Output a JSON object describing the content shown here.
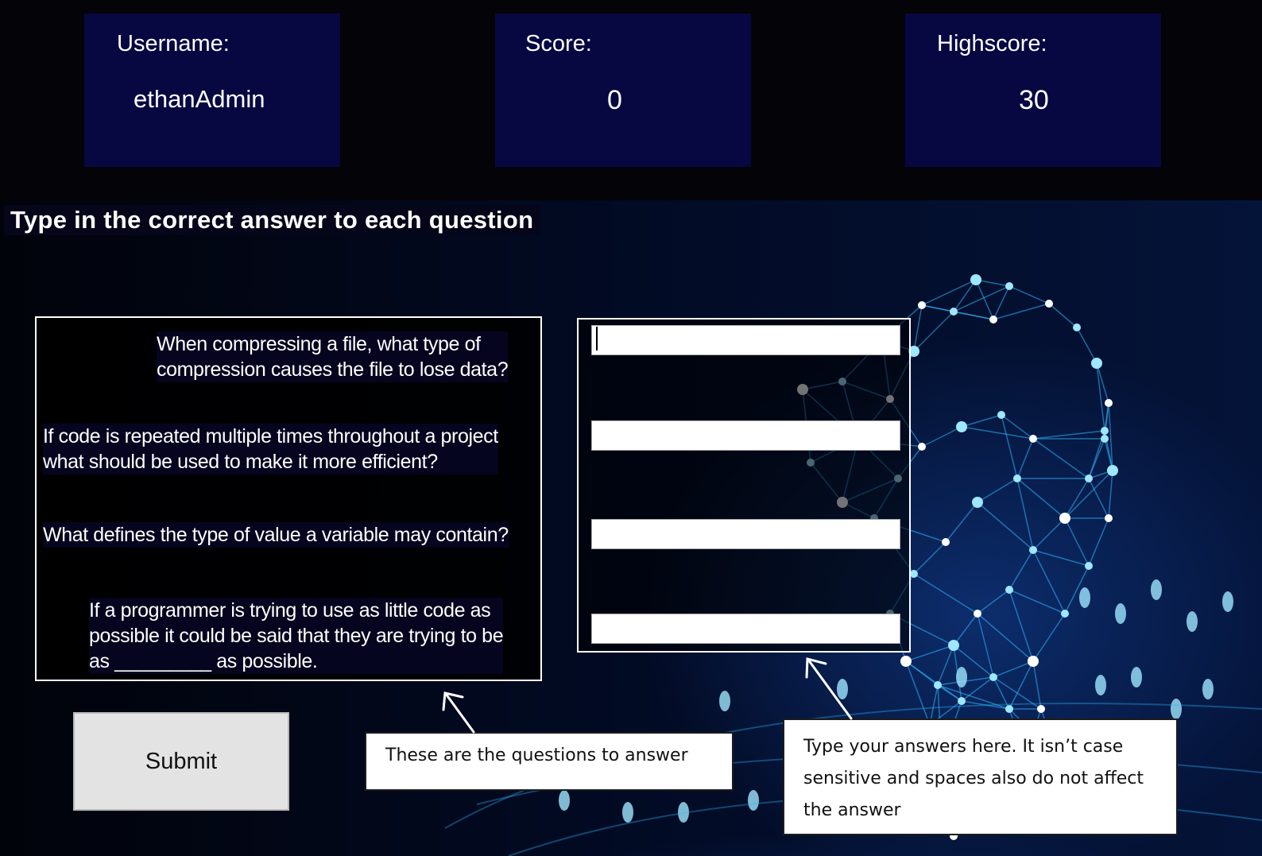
{
  "stats": {
    "username": {
      "label": "Username:",
      "value": "ethanAdmin"
    },
    "score": {
      "label": "Score:",
      "value": "0"
    },
    "highscore": {
      "label": "Highscore:",
      "value": "30"
    }
  },
  "instruction": "Type in the correct answer to each question",
  "questions": [
    {
      "lines": [
        "When compressing a file, what type of",
        "compression causes the file to lose data?"
      ]
    },
    {
      "lines": [
        "If code is repeated multiple times throughout a project",
        "what should be used to make it more efficient?"
      ]
    },
    {
      "lines": [
        "What defines the type of value a variable may contain?"
      ]
    },
    {
      "lines": [
        "If a programmer is trying to use as little code as",
        "possible it could be said that they are trying to be",
        "as _________ as possible."
      ]
    }
  ],
  "answers": [
    {
      "value": ""
    },
    {
      "value": ""
    },
    {
      "value": ""
    },
    {
      "value": ""
    }
  ],
  "submit_label": "Submit",
  "callouts": {
    "questions_note": "These are the questions to answer",
    "answers_note": "Type your answers here. It isn’t case sensitive and spaces also do not affect the answer"
  },
  "colors": {
    "card_bg": "#070742",
    "network_accent": "#2fb6ff",
    "node_glow": "#9fe6ff"
  }
}
